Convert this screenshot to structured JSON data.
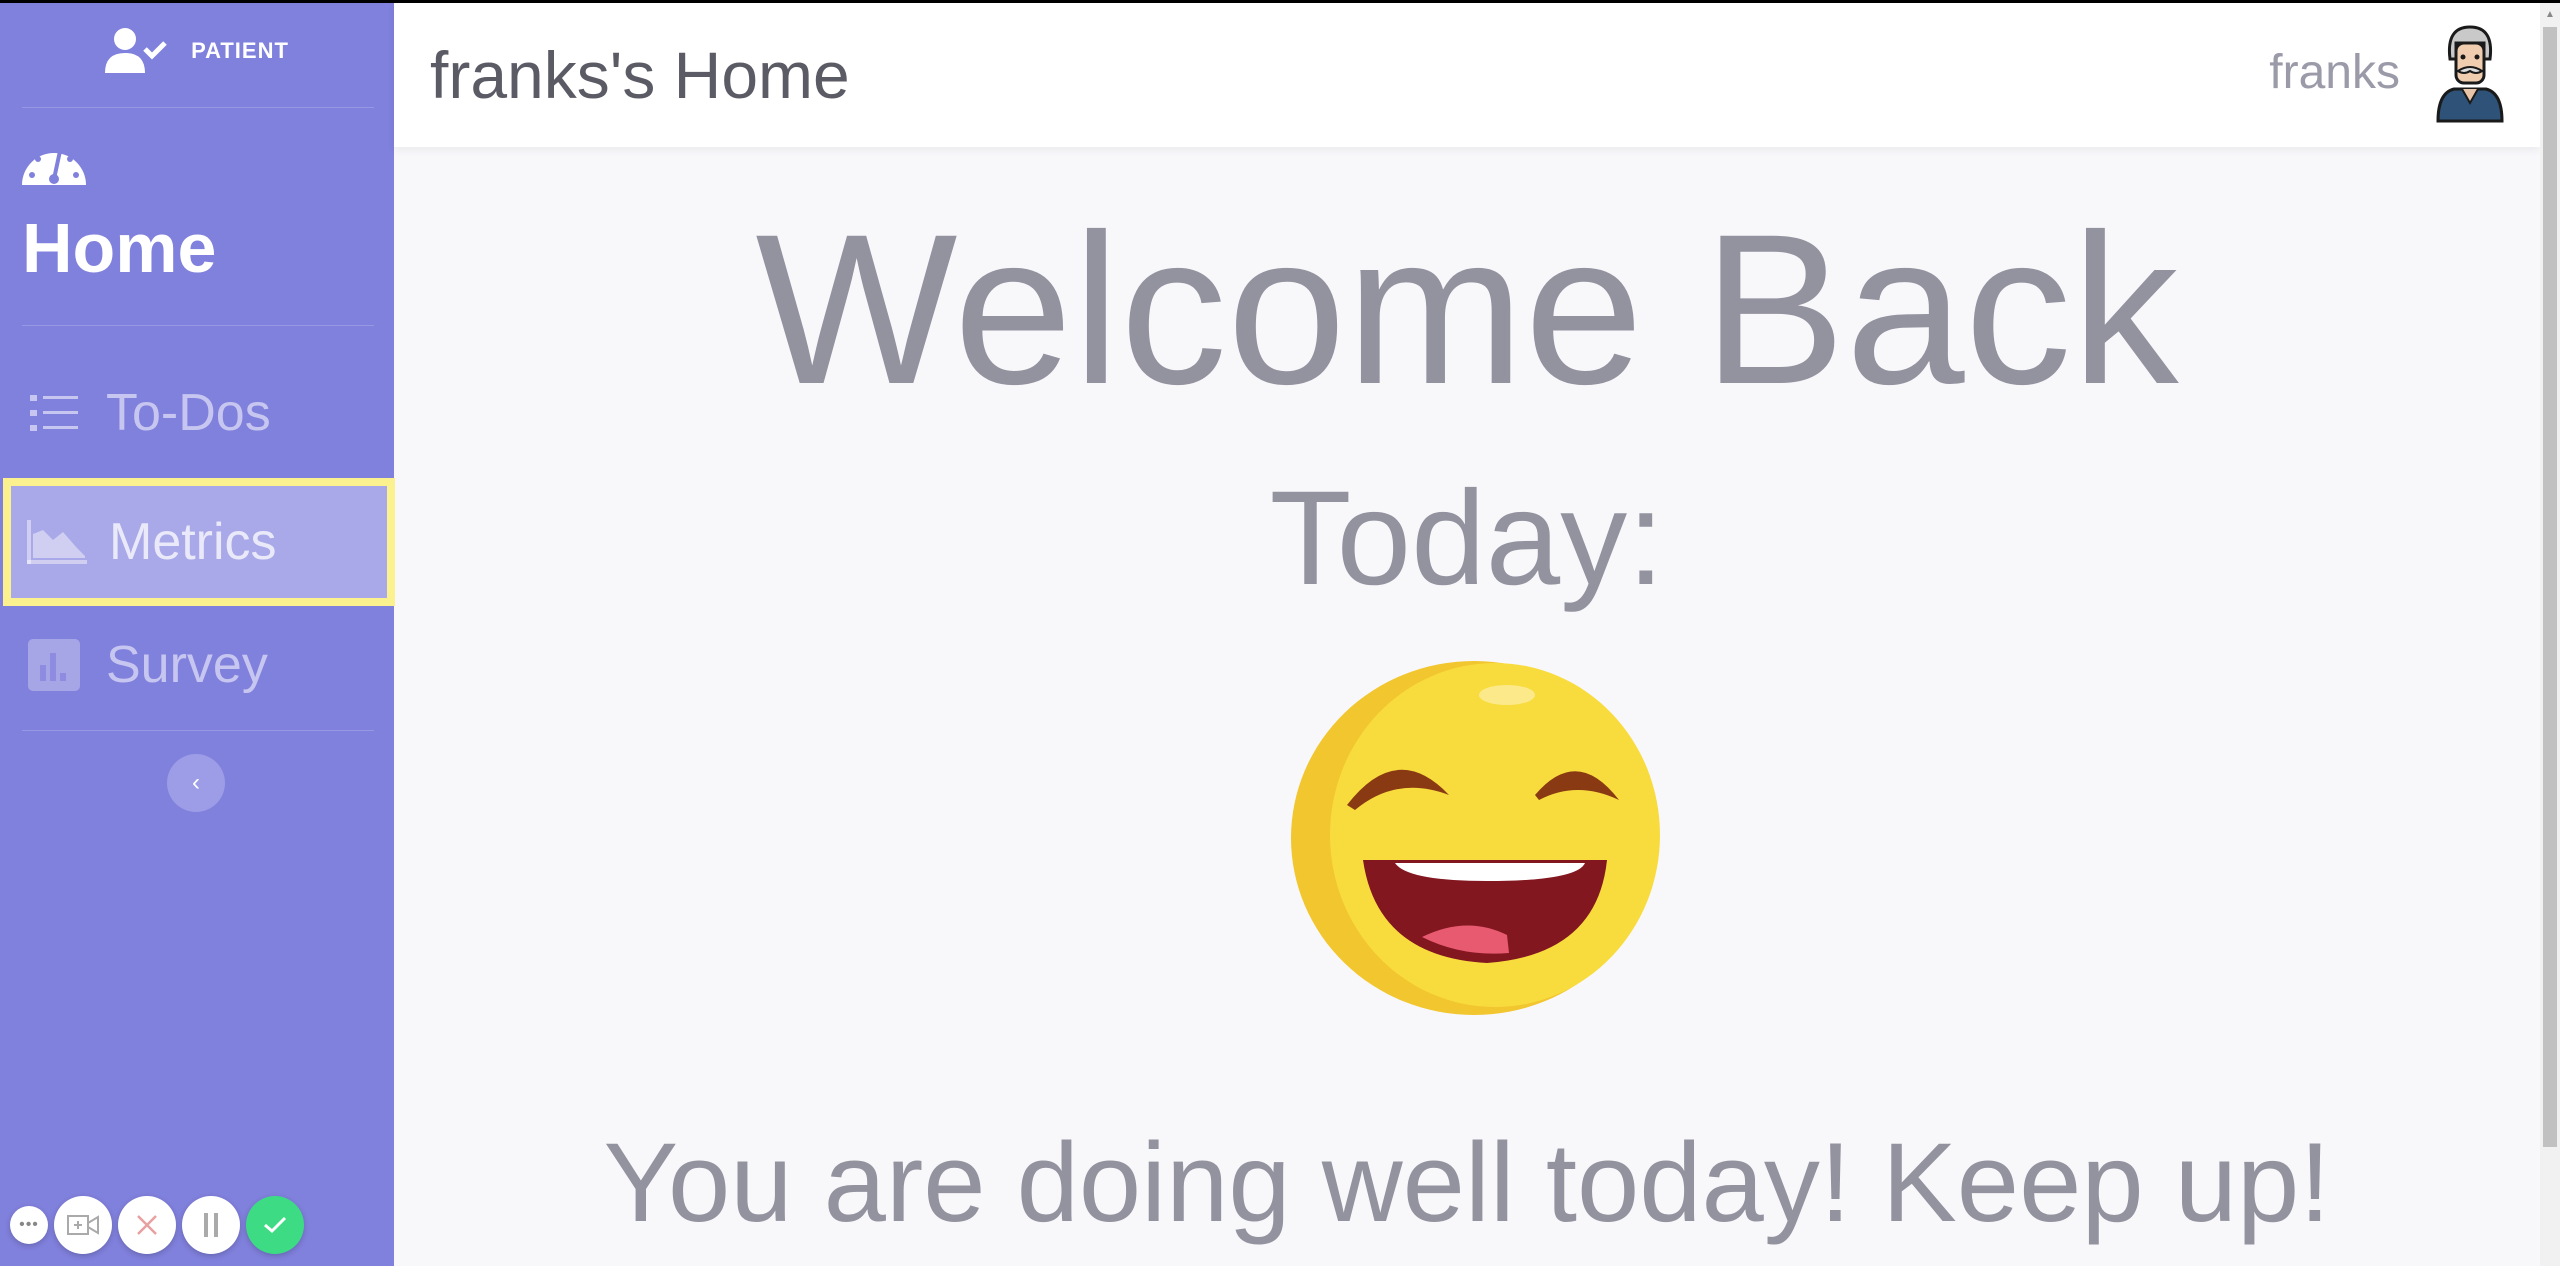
{
  "sidebar": {
    "role_label": "PATIENT",
    "home_label": "Home",
    "items": [
      {
        "label": "To-Dos",
        "icon": "list-icon"
      },
      {
        "label": "Metrics",
        "icon": "area-chart-icon",
        "active": true
      },
      {
        "label": "Survey",
        "icon": "bar-chart-icon"
      }
    ],
    "collapse_glyph": "‹",
    "controls": [
      "more",
      "camera",
      "cancel",
      "pause",
      "confirm"
    ]
  },
  "header": {
    "title": "franks's Home",
    "username": "franks"
  },
  "main": {
    "welcome": "Welcome Back",
    "today": "Today:",
    "mood": "laughing-face",
    "message": "You are doing well today! Keep up!"
  },
  "colors": {
    "sidebar": "#8080dd",
    "highlight": "#fbf18f",
    "confirm": "#3ddc84",
    "text": "#93929f"
  }
}
